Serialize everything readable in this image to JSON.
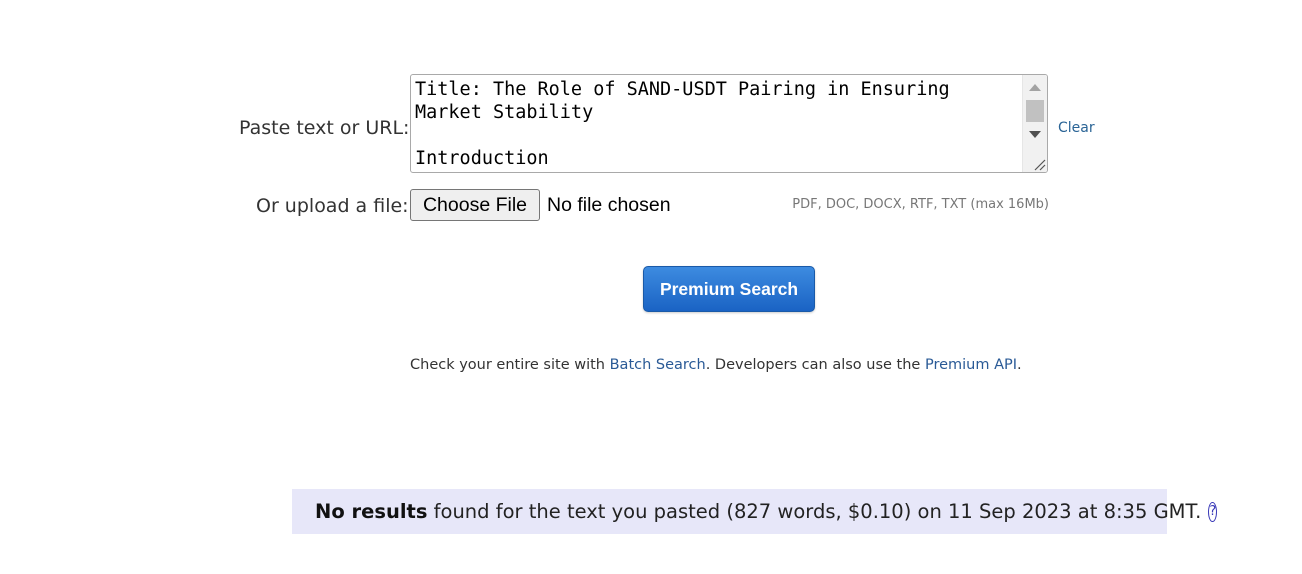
{
  "form": {
    "paste_label": "Paste text or URL:",
    "textarea_value": "Title: The Role of SAND-USDT Pairing in Ensuring Market Stability\n\nIntroduction",
    "clear_label": "Clear",
    "upload_label": "Or upload a file:",
    "choose_file_label": "Choose File",
    "file_status": "No file chosen",
    "file_types": "PDF, DOC, DOCX, RTF, TXT (max 16Mb)"
  },
  "search_button": {
    "label": "Premium Search",
    "color": "#1a63c4"
  },
  "promo": {
    "prefix": "Check your entire site with ",
    "batch_link": "Batch Search",
    "middle": ". Developers can also use the ",
    "api_link": "Premium API",
    "suffix": "."
  },
  "result": {
    "bold": "No results",
    "text": " found for the text you pasted (827 words, $0.10) on 11 Sep 2023 at 8:35 GMT.",
    "help_icon": "question-circle-icon",
    "help_glyph": "?",
    "background": "#e7e7f9"
  }
}
